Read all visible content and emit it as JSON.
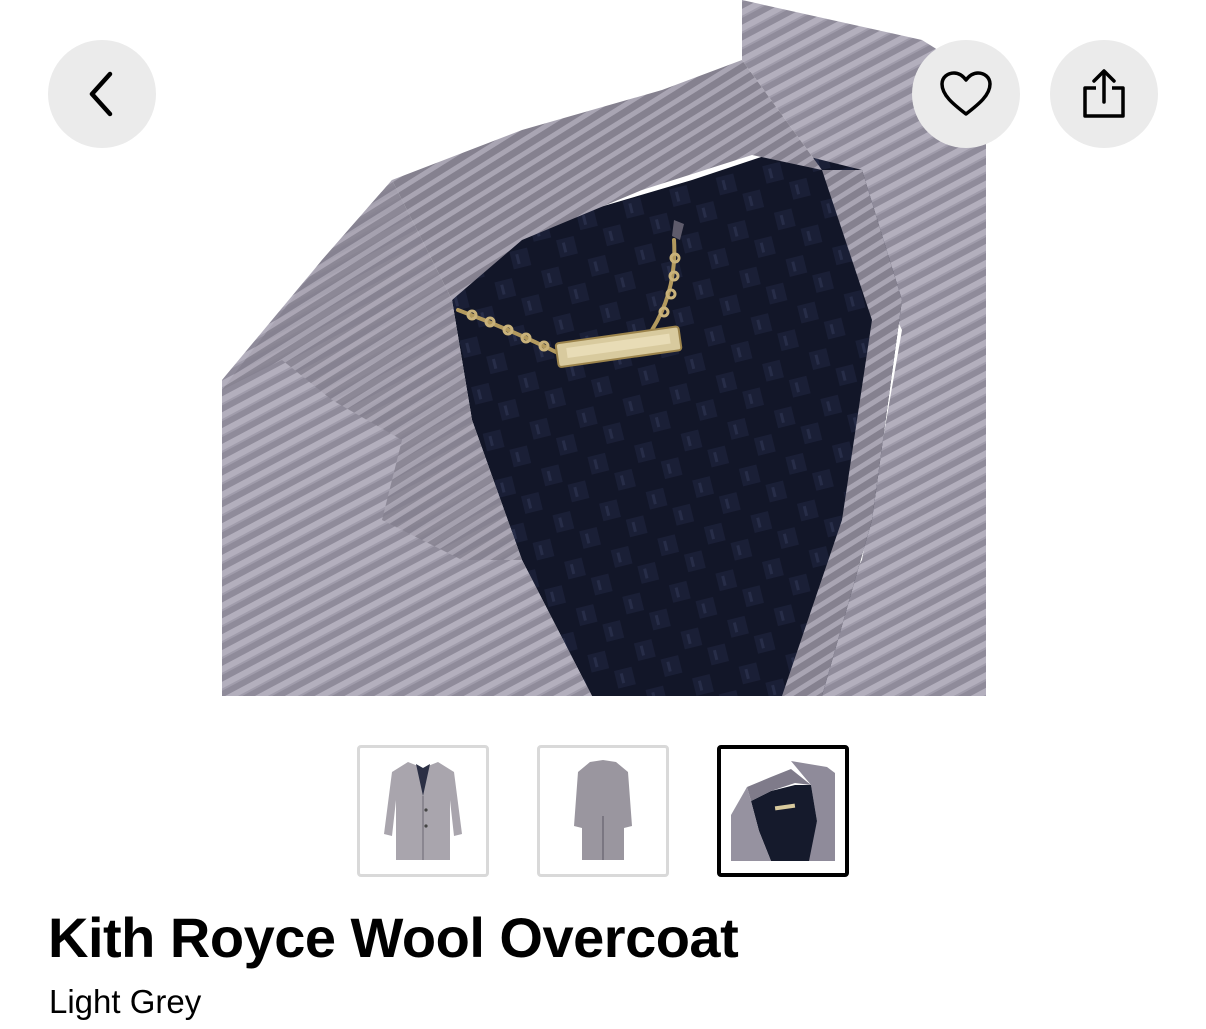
{
  "product": {
    "title": "Kith Royce Wool Overcoat",
    "colorway": "Light Grey"
  },
  "header": {
    "back_icon": "chevron-left-icon",
    "favorite_icon": "heart-icon",
    "share_icon": "share-icon"
  },
  "gallery": {
    "selected_index": 2,
    "thumbnails": [
      {
        "view": "front"
      },
      {
        "view": "back"
      },
      {
        "view": "collar-detail"
      }
    ]
  },
  "colors": {
    "button_bg": "#ebebeb",
    "wool_grey": "#8e8a99",
    "lining_navy": "#101425",
    "chain_gold": "#b39a5e",
    "thumb_border": "#d9d9d9",
    "thumb_selected_border": "#000000"
  }
}
